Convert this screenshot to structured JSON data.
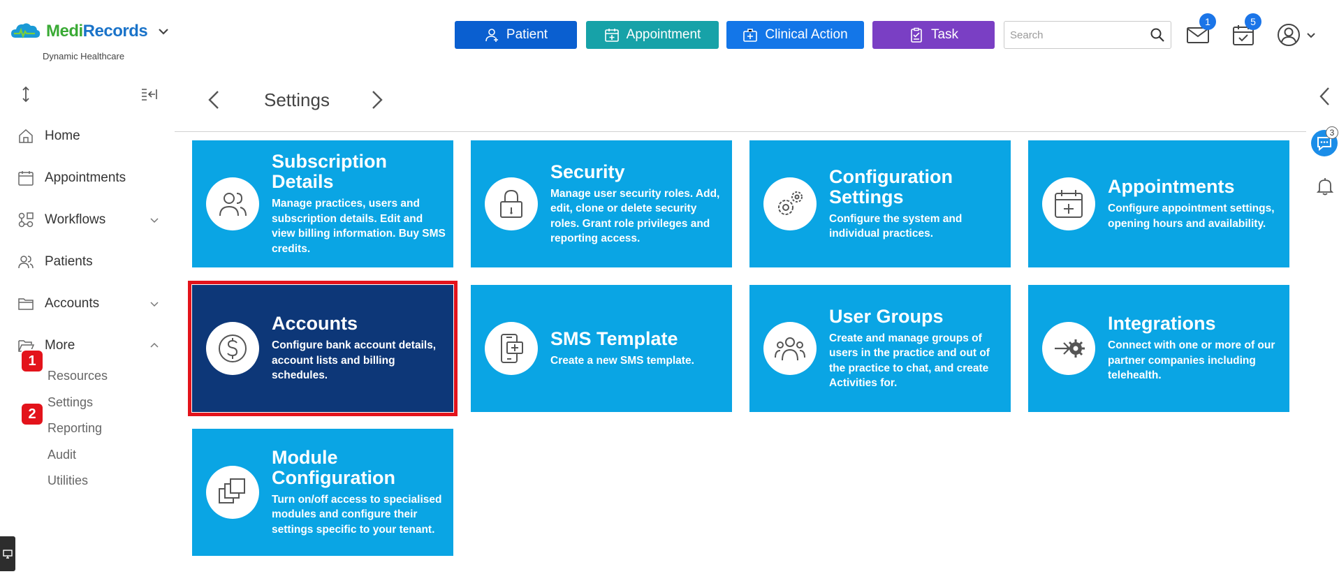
{
  "brand": {
    "name_part1": "Medi",
    "name_part2": "Records",
    "subtitle": "Dynamic Healthcare"
  },
  "header": {
    "buttons": {
      "patient": "Patient",
      "appointment": "Appointment",
      "clinical_action": "Clinical Action",
      "task": "Task"
    },
    "search_placeholder": "Search",
    "mail_count": "1",
    "calendar_count": "5"
  },
  "sidebar": {
    "items": [
      {
        "label": "Home"
      },
      {
        "label": "Appointments"
      },
      {
        "label": "Workflows"
      },
      {
        "label": "Patients"
      },
      {
        "label": "Accounts"
      },
      {
        "label": "More"
      }
    ],
    "more_sub": [
      "Resources",
      "Settings",
      "Reporting",
      "Audit",
      "Utilities"
    ]
  },
  "markers": [
    "1",
    "2"
  ],
  "page": {
    "title": "Settings"
  },
  "tiles": [
    {
      "title": "Subscription Details",
      "desc": "Manage practices, users and subscription details. Edit and view billing information. Buy SMS credits."
    },
    {
      "title": "Security",
      "desc": "Manage user security roles. Add, edit, clone or delete security roles. Grant role privileges and reporting access."
    },
    {
      "title": "Configuration Settings",
      "desc": "Configure the system and individual practices."
    },
    {
      "title": "Appointments",
      "desc": "Configure appointment settings, opening hours and availability."
    },
    {
      "title": "Accounts",
      "desc": "Configure bank account details, account lists and billing schedules."
    },
    {
      "title": "SMS Template",
      "desc": "Create a new SMS template."
    },
    {
      "title": "User Groups",
      "desc": "Create and manage groups of users in the practice and out of the practice to chat, and create Activities for."
    },
    {
      "title": "Integrations",
      "desc": "Connect with one or more of our partner companies including telehealth."
    },
    {
      "title": "Module Configuration",
      "desc": "Turn on/off access to specialised modules and configure their settings specific to your tenant."
    }
  ],
  "right_panel": {
    "chat_count": "3"
  },
  "colors": {
    "tile": "#0aa5e4",
    "tile_active": "#0d3778",
    "highlight": "#e3131b",
    "patient_btn": "#0a5fd0",
    "appointment_btn": "#17a2a8",
    "clinical_btn": "#1376e8",
    "task_btn": "#7a3fc4"
  }
}
